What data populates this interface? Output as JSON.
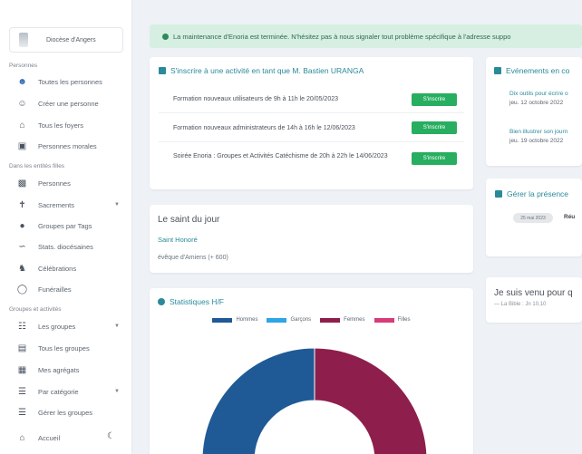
{
  "sidebar": {
    "diocese_name": "Diocèse d'Angers",
    "sections": [
      {
        "title": "Personnes"
      },
      {
        "title": "Dans les entités filles"
      },
      {
        "title": "Groupes et activités"
      }
    ],
    "items": [
      {
        "label": "Toutes les personnes",
        "icon": "person-icon"
      },
      {
        "label": "Créer une personne",
        "icon": "person-add-icon"
      },
      {
        "label": "Tous les foyers",
        "icon": "house-icon"
      },
      {
        "label": "Personnes morales",
        "icon": "building-icon"
      },
      {
        "label": "Personnes",
        "icon": "id-card-icon"
      },
      {
        "label": "Sacrements",
        "icon": "cross-icon"
      },
      {
        "label": "Groupes par Tags",
        "icon": "tag-icon"
      },
      {
        "label": "Stats. diocésaines",
        "icon": "chart-icon"
      },
      {
        "label": "Célébrations",
        "icon": "celebration-icon"
      },
      {
        "label": "Funérailles",
        "icon": "funeral-icon"
      },
      {
        "label": "Les groupes",
        "icon": "group-icon"
      },
      {
        "label": "Tous les groupes",
        "icon": "groups-list-icon"
      },
      {
        "label": "Mes agrégats",
        "icon": "aggregate-icon"
      },
      {
        "label": "Par catégorie",
        "icon": "category-icon"
      },
      {
        "label": "Gérer les groupes",
        "icon": "manage-icon"
      },
      {
        "label": "Accueil",
        "icon": "home-icon"
      }
    ],
    "theme_toggle_icon": "moon-icon"
  },
  "banner": {
    "text": "La maintenance d'Enoria est terminée. N'hésitez pas à nous signaler tout problème spécifique à l'adresse suppo"
  },
  "inscriptions": {
    "title": "S'inscrire à une activité en tant que M. Bastien URANGA",
    "button_label": "S'inscrire",
    "rows": [
      {
        "text": "Formation nouveaux utilisateurs de 9h à 11h le 20/05/2023"
      },
      {
        "text": "Formation nouveaux administrateurs de 14h à 16h le 12/06/2023"
      },
      {
        "text": "Soirée Enoria : Groupes et Activités Catéchisme de 20h à 22h le 14/06/2023"
      }
    ]
  },
  "saint": {
    "heading": "Le saint du jour",
    "name": "Saint Honoré",
    "desc": "évêque d'Amiens (+ 600)"
  },
  "stats": {
    "title": "Statistiques H/F"
  },
  "chart_data": {
    "type": "pie",
    "variant": "half-donut",
    "series": [
      {
        "name": "Hommes",
        "value": 0.5,
        "color": "#1f5a96"
      },
      {
        "name": "Garçons",
        "value": 0,
        "color": "#2fa4e7"
      },
      {
        "name": "Femmes",
        "value": 0.5,
        "color": "#8e1e4b"
      },
      {
        "name": "Filles",
        "value": 0,
        "color": "#d63c7a"
      }
    ],
    "legend": "top"
  },
  "events": {
    "title": "Evénements en co",
    "items": [
      {
        "title": "Dix outils pour écrire o",
        "date": "jeu. 12 octobre 2022"
      },
      {
        "title": "Bien illustrer son journ",
        "date": "jeu. 19 octobre 2022"
      }
    ]
  },
  "presence": {
    "title": "Gérer la présence",
    "date_pill": "25 mai 2023",
    "label": "Réu"
  },
  "quote": {
    "text": "Je suis venu pour q",
    "source": "— La Bible : Jn 10,10"
  }
}
